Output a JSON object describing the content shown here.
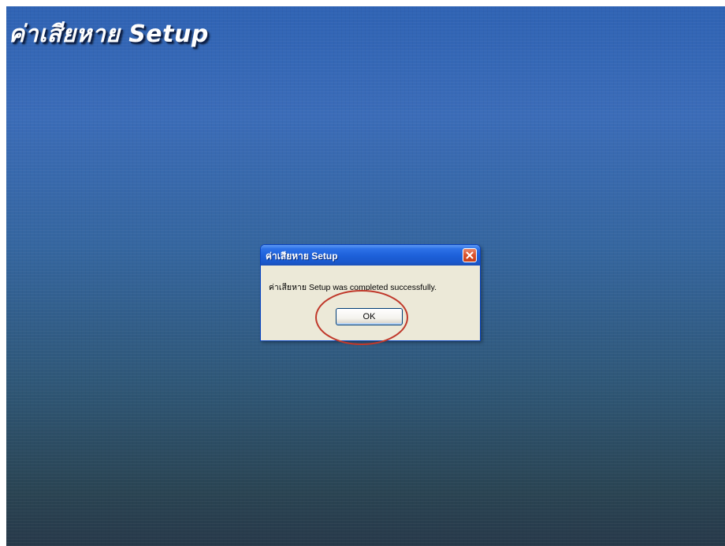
{
  "desktop": {
    "title": "ค่าเสียหาย Setup"
  },
  "dialog": {
    "title": "ค่าเสียหาย Setup",
    "message": "ค่าเสียหาย Setup was completed successfully.",
    "ok_label": "OK",
    "close_icon": "close-icon"
  },
  "annotation": {
    "shape": "ellipse",
    "color": "#c0392b",
    "target": "ok-button"
  },
  "colors": {
    "titlebar": "#1c5fd8",
    "dialog_bg": "#ece9d8",
    "close_button": "#d9522c"
  }
}
